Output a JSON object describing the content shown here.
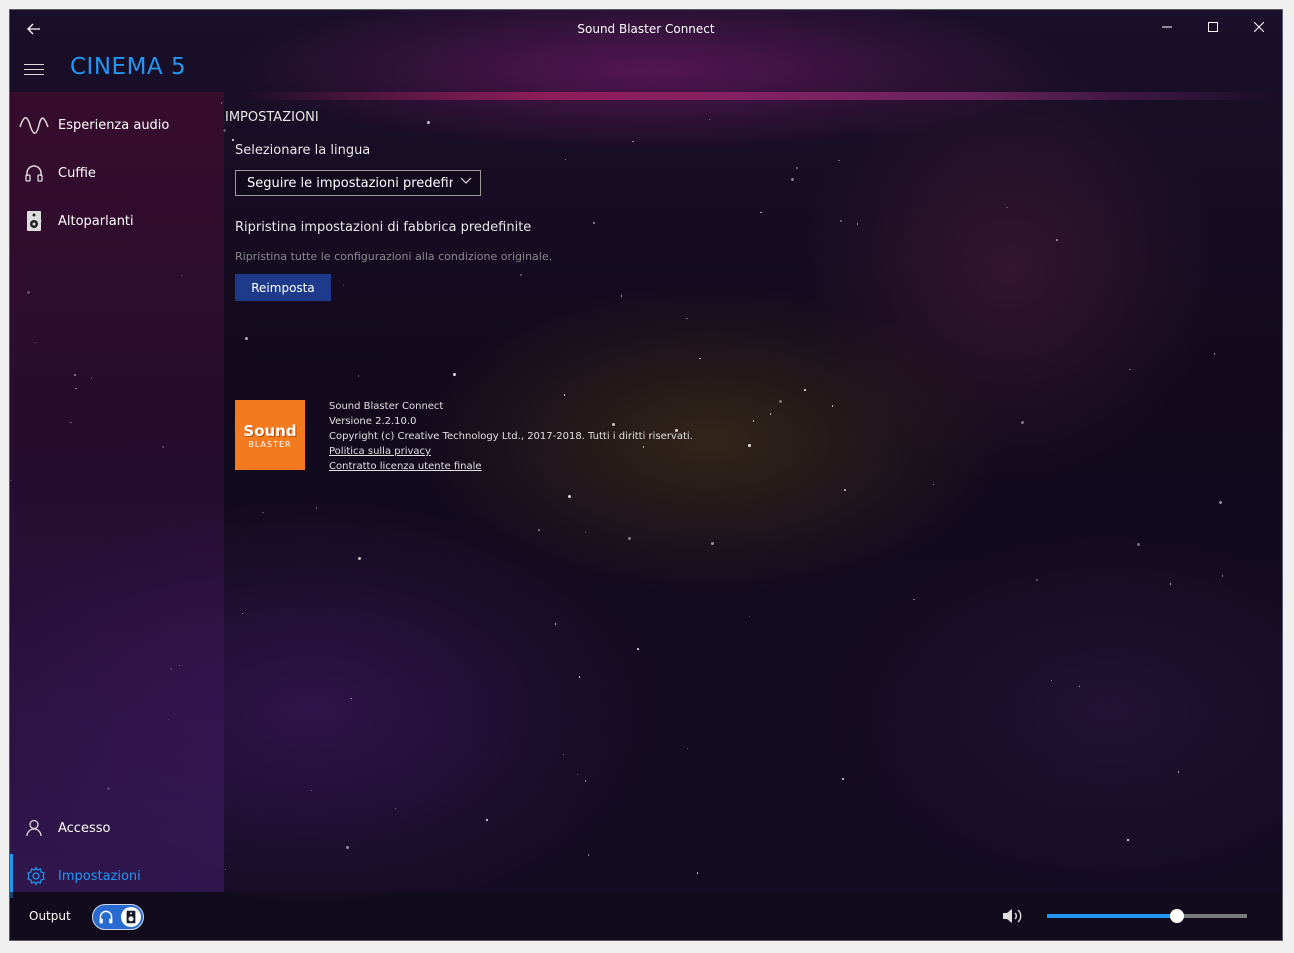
{
  "window": {
    "title": "Sound Blaster Connect",
    "back_icon": "arrow-left-icon",
    "controls": [
      "minimize-icon",
      "maximize-icon",
      "close-icon"
    ]
  },
  "header": {
    "menu_icon": "hamburger-icon",
    "device_name": "CINEMA 5",
    "accent_color": "#2196f3"
  },
  "sidebar": {
    "items": [
      {
        "label": "Esperienza audio",
        "icon": "waveform-icon"
      },
      {
        "label": "Cuffie",
        "icon": "headphones-icon"
      },
      {
        "label": "Altoparlanti",
        "icon": "speaker-icon"
      }
    ],
    "bottom_items": [
      {
        "label": "Accesso",
        "icon": "person-icon"
      },
      {
        "label": "Impostazioni",
        "icon": "gear-icon",
        "active": true
      }
    ]
  },
  "settings": {
    "section_title": "IMPOSTAZIONI",
    "language_label": "Selezionare la lingua",
    "language_value": "Seguire le impostazioni predefinite",
    "reset_title": "Ripristina impostazioni di fabbrica predefinite",
    "reset_description": "Ripristina tutte le configurazioni alla condizione originale.",
    "reset_button": "Reimposta",
    "button_color": "#1e3a8a"
  },
  "about": {
    "logo_line1": "Sound",
    "logo_line2": "BLASTER",
    "logo_color": "#f47a1f",
    "app_name": "Sound Blaster Connect",
    "version": "Versione  2.2.10.0",
    "copyright": "Copyright (c) Creative Technology Ltd., 2017-2018. Tutti i diritti riservati.",
    "privacy_link": "Politica sulla privacy",
    "eula_link": "Contratto licenza utente finale"
  },
  "bottom": {
    "output_label": "Output",
    "output_toggle_icons": [
      "headphones-icon",
      "speaker-icon"
    ],
    "volume_icon": "volume-icon",
    "volume_level": 0.65
  }
}
